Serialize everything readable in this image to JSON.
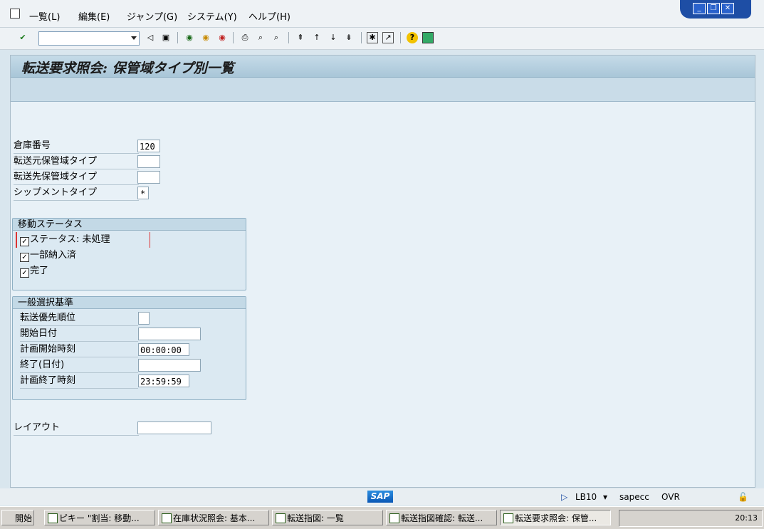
{
  "menu": [
    "一覧(L)",
    "編集(E)",
    "ジャンプ(G)",
    "システム(Y)",
    "ヘルプ(H)"
  ],
  "page_title": "転送要求照会: 保管域タイプ別一覧",
  "fields": {
    "warehouse_label": "倉庫番号",
    "warehouse_value": "120",
    "src_type_label": "転送元保管域タイプ",
    "dst_type_label": "転送先保管域タイプ",
    "shipment_type_label": "シップメントタイプ",
    "shipment_type_value": "*"
  },
  "movement_status": {
    "title": "移動ステータス",
    "items": [
      "ステータス: 未処理",
      "一部納入済",
      "完了"
    ]
  },
  "general": {
    "title": "一般選択基準",
    "priority_label": "転送優先順位",
    "start_date_label": "開始日付",
    "planned_start_time_label": "計画開始時刻",
    "planned_start_time_value": "00:00:00",
    "end_date_label": "終了(日付)",
    "planned_end_time_label": "計画終了時刻",
    "planned_end_time_value": "23:59:59"
  },
  "layout_label": "レイアウト",
  "status": {
    "logo": "SAP",
    "tcode": "LB10",
    "system": "sapecc",
    "mode": "OVR"
  },
  "taskbar": {
    "start": "開始",
    "buttons": [
      "ピキー \"割当: 移動...",
      "在庫状況照会: 基本...",
      "転送指図: 一覧",
      "転送指図確認: 転送...",
      "転送要求照会: 保管..."
    ],
    "clock": "20:13"
  }
}
